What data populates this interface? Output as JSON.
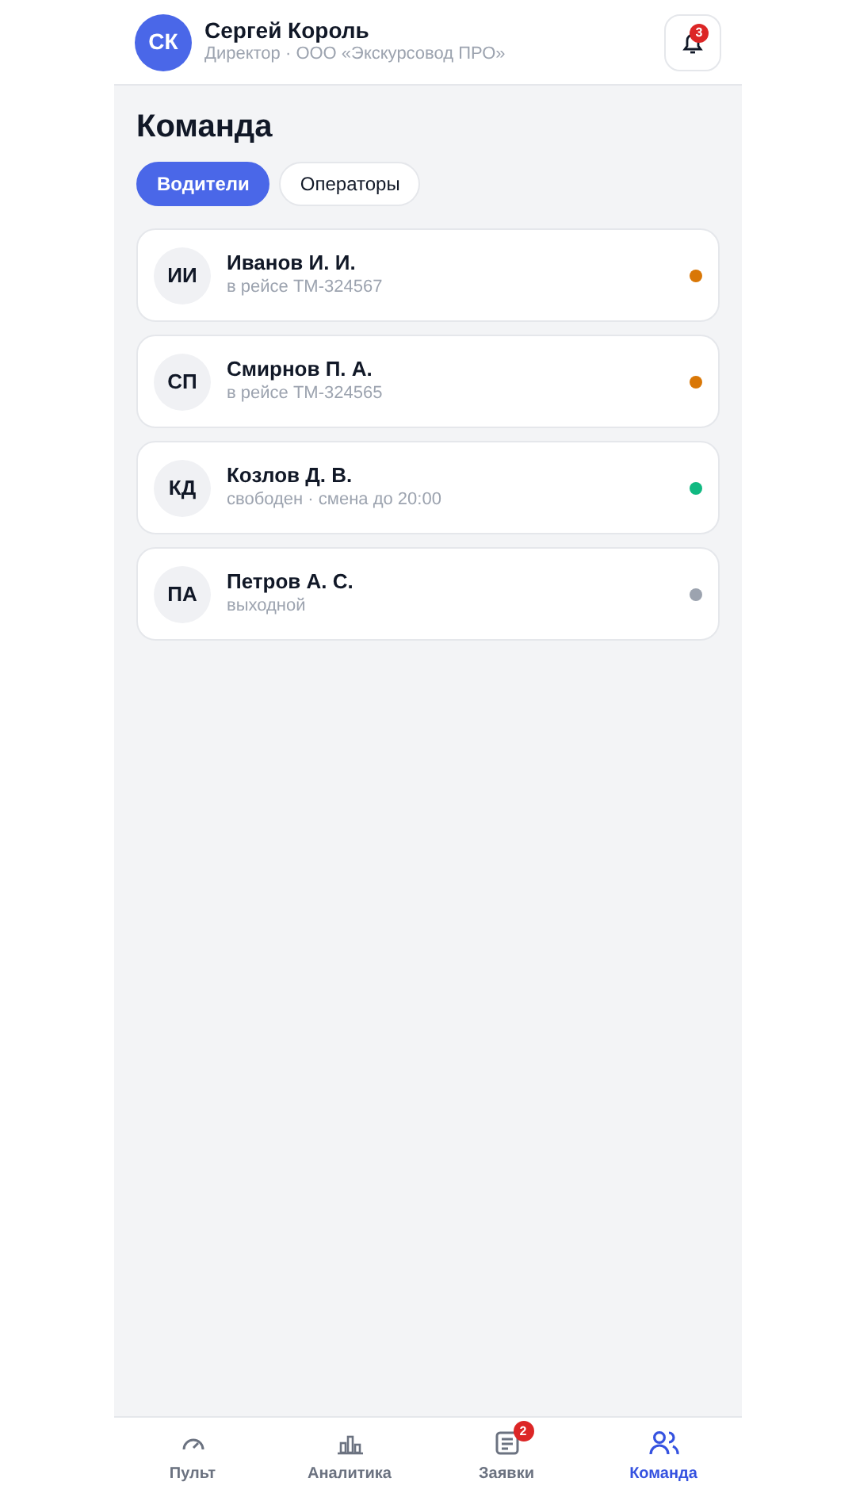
{
  "header": {
    "avatar": "СК",
    "name": "Сергей Король",
    "subtitle": "Директор · ООО «Экскурсовод ПРО»",
    "notifications": "3"
  },
  "title": "Команда",
  "tabs": [
    {
      "label": "Водители",
      "selected": true
    },
    {
      "label": "Операторы",
      "selected": false
    }
  ],
  "members": [
    {
      "initials": "ИИ",
      "name": "Иванов И. И.",
      "status": "в рейсе ТМ-324567",
      "color": "#d97706"
    },
    {
      "initials": "СП",
      "name": "Смирнов П. А.",
      "status": "в рейсе ТМ-324565",
      "color": "#d97706"
    },
    {
      "initials": "КД",
      "name": "Козлов Д. В.",
      "status": "свободен · смена до 20:00",
      "color": "#10b981"
    },
    {
      "initials": "ПА",
      "name": "Петров А. С.",
      "status": "выходной",
      "color": "#9ca3af"
    }
  ],
  "nav": [
    {
      "kind": "gauge",
      "label": "Пульт",
      "selected": false
    },
    {
      "kind": "chart",
      "label": "Аналитика",
      "selected": false
    },
    {
      "kind": "list",
      "label": "Заявки",
      "selected": false,
      "badge": "2"
    },
    {
      "kind": "team",
      "label": "Команда",
      "selected": true
    }
  ]
}
